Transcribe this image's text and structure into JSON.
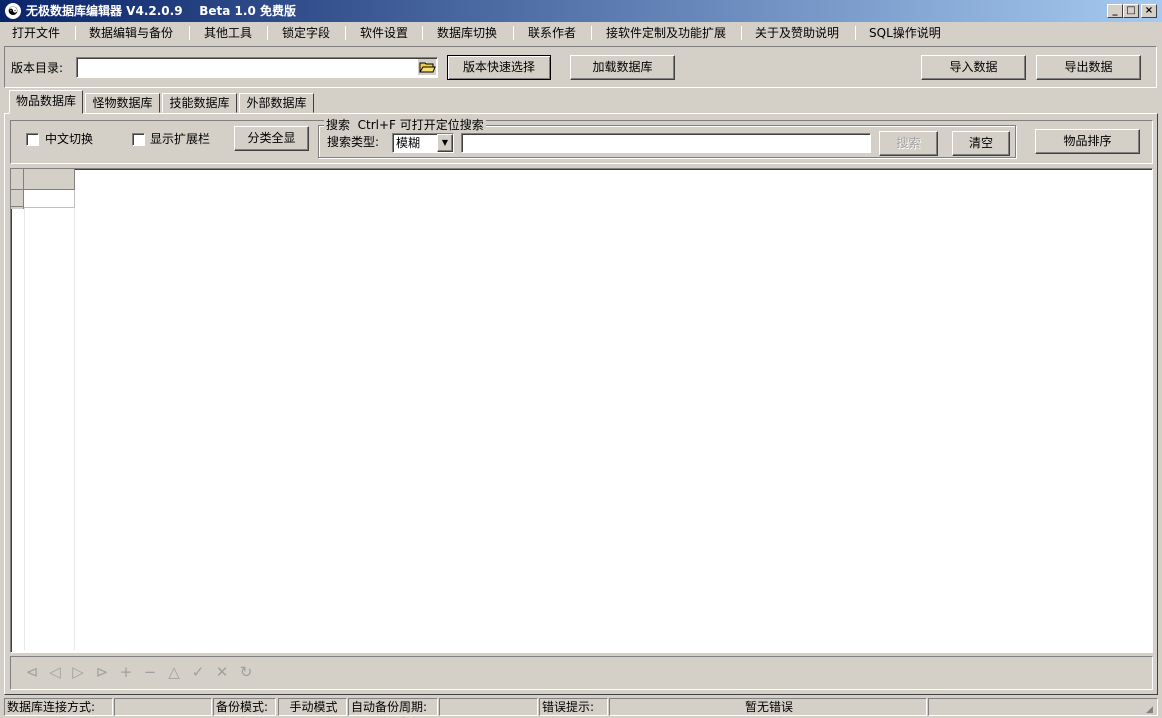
{
  "window": {
    "title": "无极数据库编辑器 V4.2.0.9    Beta 1.0 免费版",
    "controls": {
      "minimize": "_",
      "maximize": "□",
      "close": "×"
    }
  },
  "menu": [
    "打开文件",
    "数据编辑与备份",
    "其他工具",
    "锁定字段",
    "软件设置",
    "数据库切换",
    "联系作者",
    "接软件定制及功能扩展",
    "关于及赞助说明",
    "SQL操作说明"
  ],
  "toolbar": {
    "version_dir_label": "版本目录:",
    "version_dir_value": "",
    "quick_select_button": "版本快速选择",
    "load_db_button": "加载数据库",
    "import_button": "导入数据",
    "export_button": "导出数据"
  },
  "tabs": [
    "物品数据库",
    "怪物数据库",
    "技能数据库",
    "外部数据库"
  ],
  "active_tab": 0,
  "filters": {
    "chinese_toggle_label": "中文切换",
    "show_ext_label": "显示扩展栏",
    "show_all_button": "分类全显",
    "search_group_title": "搜索  Ctrl+F 可打开定位搜索",
    "search_type_label": "搜索类型:",
    "search_type_value": "模糊",
    "search_value": "",
    "search_button": "搜索",
    "clear_button": "清空",
    "sort_button": "物品排序"
  },
  "navigator": [
    "first-icon",
    "prior-icon",
    "next-icon",
    "last-icon",
    "insert-icon",
    "delete-icon",
    "edit-icon",
    "post-icon",
    "cancel-icon",
    "refresh-icon"
  ],
  "status": {
    "conn_label": "数据库连接方式:",
    "conn_value": "",
    "backup_label": "备份模式:",
    "backup_value": "手动模式",
    "auto_backup_label": "自动备份周期:",
    "auto_backup_value": "",
    "error_label": "错误提示:",
    "error_value": "暂无错误"
  }
}
